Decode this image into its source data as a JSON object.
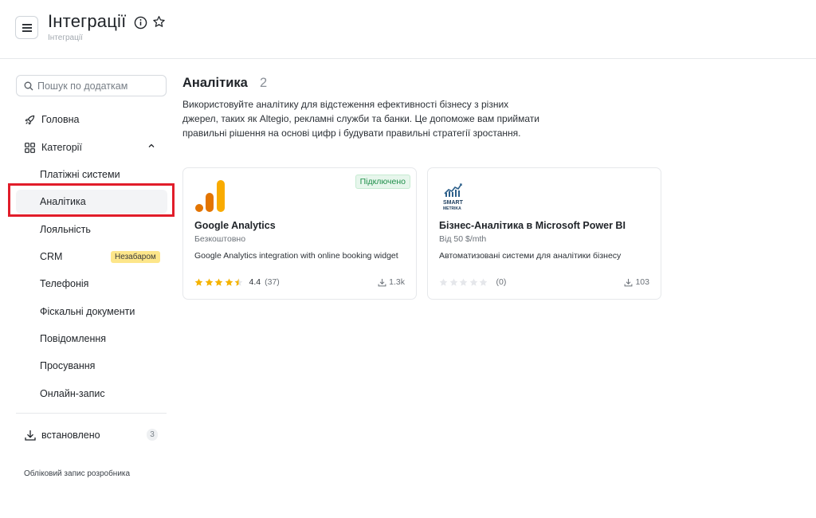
{
  "header": {
    "title": "Інтеграції",
    "subtitle": "Інтеграції"
  },
  "search": {
    "placeholder": "Пошук по додаткам"
  },
  "sidebar": {
    "home_label": "Головна",
    "categories_label": "Категорії",
    "categories": [
      {
        "label": "Платіжні системи"
      },
      {
        "label": "Аналітика",
        "active": true
      },
      {
        "label": "Лояльність"
      },
      {
        "label": "CRM",
        "badge": "Незабаром"
      },
      {
        "label": "Телефонія"
      },
      {
        "label": "Фіскальні документи"
      },
      {
        "label": "Повідомлення"
      },
      {
        "label": "Просування"
      },
      {
        "label": "Онлайн-запис"
      }
    ],
    "installed_label": "встановлено",
    "installed_count": "3",
    "developer_link": "Обліковий запис розробника"
  },
  "main": {
    "title": "Аналітика",
    "count": "2",
    "description": "Використовуйте аналітику для відстеження ефективності бізнесу з різних джерел, таких як Altegio, рекламні служби та банки. Це допоможе вам приймати правильні рішення на основі цифр і будувати правильні стратегії зростання.",
    "cards": [
      {
        "name": "Google Analytics",
        "price": "Безкоштовно",
        "description": "Google Analytics integration with online booking widget",
        "rating": "4.4",
        "rating_count": "(37)",
        "rating_value": 4.4,
        "downloads": "1.3k",
        "status_badge": "Підключено",
        "icon": "google-analytics-logo"
      },
      {
        "name": "Бізнес-Аналітика в Microsoft Power BI",
        "price": "Від 50 $/mth",
        "description": "Автоматизовані системи для аналітики бізнесу",
        "rating": "",
        "rating_count": "(0)",
        "rating_value": 0,
        "downloads": "103",
        "logo_text_top": "SMART",
        "logo_text_bottom": "METRIKA",
        "icon": "smart-metrika-logo"
      }
    ]
  },
  "colors": {
    "highlight": "#e11d2a",
    "star_filled": "#f5b301",
    "star_empty": "#e5e7eb",
    "connected_green": "#1f8f4a",
    "soon_badge": "#fde68a",
    "ga_orange": "#f9ab00",
    "ga_dark_orange": "#e37400",
    "metrika_blue": "#2c5f8a"
  }
}
